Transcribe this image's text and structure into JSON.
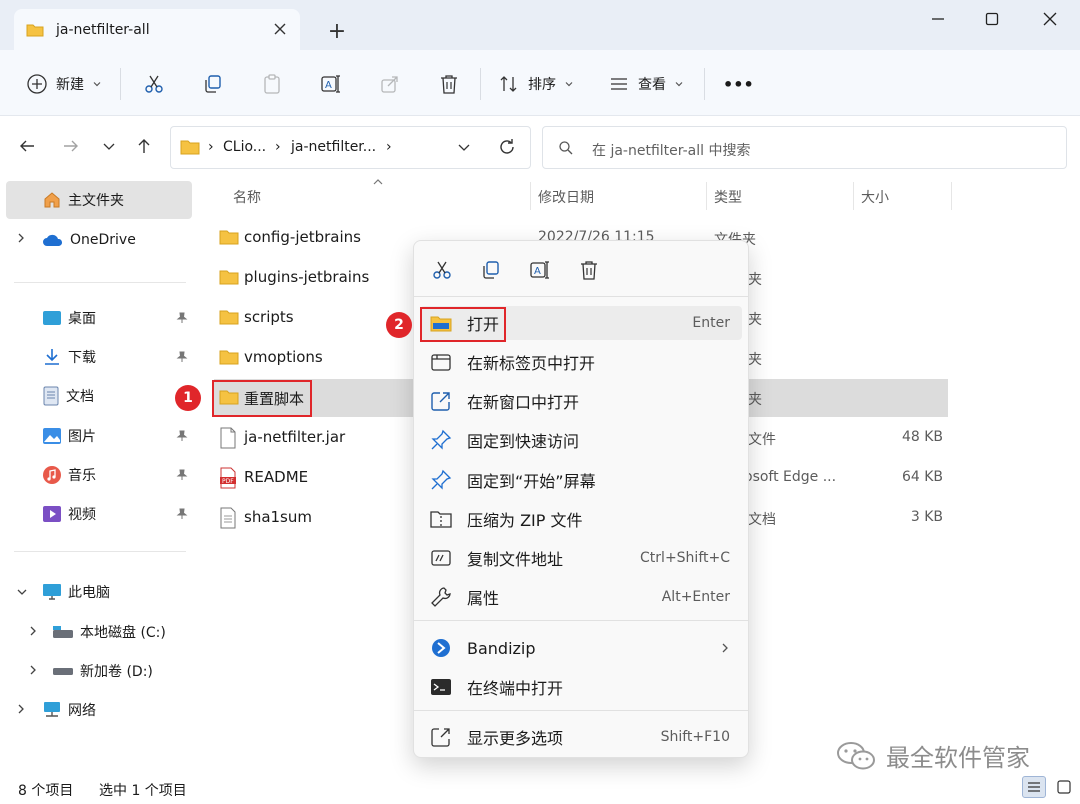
{
  "window": {
    "tab_title": "ja-netfilter-all",
    "new_tab": "+"
  },
  "toolbar": {
    "new_label": "新建",
    "sort_label": "排序",
    "view_label": "查看",
    "more": "•••"
  },
  "address": {
    "crumbs": [
      "CLio...",
      "ja-netfilter..."
    ],
    "search_placeholder": "在 ja-netfilter-all 中搜索"
  },
  "sidebar": {
    "home": "主文件夹",
    "onedrive": "OneDrive",
    "quick": [
      "桌面",
      "下载",
      "文档",
      "图片",
      "音乐",
      "视频"
    ],
    "thispc": "此电脑",
    "drives": [
      "本地磁盘 (C:)",
      "新加卷 (D:)"
    ],
    "network": "网络"
  },
  "columns": {
    "name": "名称",
    "modified": "修改日期",
    "type": "类型",
    "size": "大小"
  },
  "files": [
    {
      "name": "config-jetbrains",
      "date": "2022/7/26 11:15",
      "type": "文件夹",
      "size": ""
    },
    {
      "name": "plugins-jetbrains",
      "date": "",
      "type": "夹",
      "size": ""
    },
    {
      "name": "scripts",
      "date": "",
      "type": "夹",
      "size": ""
    },
    {
      "name": "vmoptions",
      "date": "",
      "type": "夹",
      "size": ""
    },
    {
      "name": "重置脚本",
      "date": "",
      "type": "夹",
      "size": ""
    },
    {
      "name": "ja-netfilter.jar",
      "date": "",
      "type": "文件",
      "size": "48 KB"
    },
    {
      "name": "README",
      "date": "",
      "type": "osoft Edge ...",
      "size": "64 KB"
    },
    {
      "name": "sha1sum",
      "date": "",
      "type": "文档",
      "size": "3 KB"
    }
  ],
  "badges": [
    "1",
    "2"
  ],
  "context_menu": {
    "items": [
      {
        "label": "打开",
        "key": "Enter"
      },
      {
        "label": "在新标签页中打开",
        "key": ""
      },
      {
        "label": "在新窗口中打开",
        "key": ""
      },
      {
        "label": "固定到快速访问",
        "key": ""
      },
      {
        "label": "固定到“开始”屏幕",
        "key": ""
      },
      {
        "label": "压缩为 ZIP 文件",
        "key": ""
      },
      {
        "label": "复制文件地址",
        "key": "Ctrl+Shift+C"
      },
      {
        "label": "属性",
        "key": "Alt+Enter"
      },
      {
        "label": "Bandizip",
        "key": ""
      },
      {
        "label": "在终端中打开",
        "key": ""
      },
      {
        "label": "显示更多选项",
        "key": "Shift+F10"
      }
    ]
  },
  "status": {
    "count": "8 个项目",
    "selected": "选中 1 个项目"
  },
  "watermark": "最全软件管家",
  "colors": {
    "accent_red": "#e0262a",
    "folder_yellow": "#f5c242",
    "titlebar_bg": "#e9eef6"
  }
}
